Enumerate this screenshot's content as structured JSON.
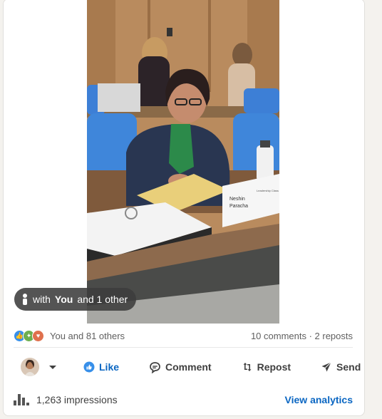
{
  "post": {
    "tag_pill": {
      "prefix": "with",
      "name": "You",
      "suffix": "and 1 other",
      "icon": "person-icon"
    },
    "photo": {
      "nameplate_line1": "Neshin",
      "nameplate_line2": "Paracha",
      "nameplate_side": "Leadership Class"
    }
  },
  "social": {
    "reaction_icons": [
      "like-icon",
      "celebrate-icon",
      "love-icon"
    ],
    "reactions_text": "You and 81 others",
    "comments_reposts": "10 comments · 2 reposts"
  },
  "actions": {
    "like": "Like",
    "comment": "Comment",
    "repost": "Repost",
    "send": "Send"
  },
  "footer": {
    "impressions": "1,263 impressions",
    "analytics": "View analytics"
  },
  "colors": {
    "accent": "#0a66c2",
    "like_react": "#378fe9",
    "celebrate_react": "#6dae4f",
    "love_react": "#df704d"
  }
}
